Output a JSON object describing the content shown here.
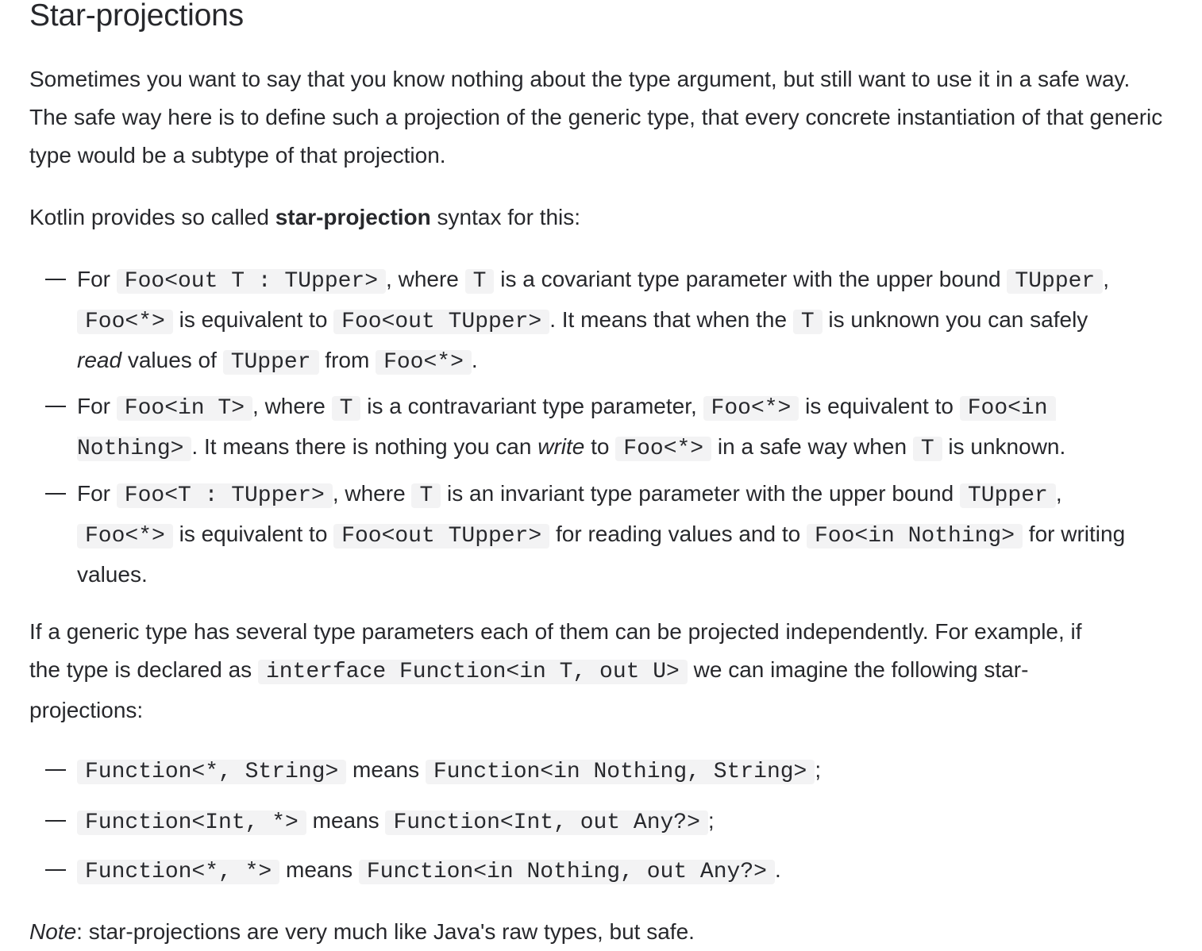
{
  "heading": "Star-projections",
  "intro": "Sometimes you want to say that you know nothing about the type argument, but still want to use it in a safe way. The safe way here is to define such a projection of the generic type, that every concrete instantiation of that generic type would be a subtype of that projection.",
  "kotlin_line": {
    "prefix": "Kotlin provides so called ",
    "bold": "star-projection",
    "suffix": " syntax for this:"
  },
  "projection_rules": [
    {
      "t1": "For ",
      "c1": "Foo<out T : TUpper>",
      "t2": ", where ",
      "c2": "T",
      "t3": " is a covariant type parameter with the upper bound ",
      "c3": "TUpper",
      "t4": ",",
      "c4": "Foo<*>",
      "t5": " is equivalent to ",
      "c5": "Foo<out TUpper>",
      "t6": ". It means that when the ",
      "c6": "T",
      "t7": " is unknown you can safely",
      "i1": "read",
      "t8": " values of ",
      "c7": "TUpper",
      "t9": " from ",
      "c8": "Foo<*>",
      "t10": "."
    },
    {
      "t1": "For ",
      "c1": "Foo<in T>",
      "t2": ", where ",
      "c2": "T",
      "t3": " is a contravariant type parameter, ",
      "c3": "Foo<*>",
      "t4": " is equivalent to ",
      "c4a": "Foo<in",
      "c4b": "Nothing>",
      "t5": ". It means there is nothing you can ",
      "i1": "write",
      "t6": " to ",
      "c5": "Foo<*>",
      "t7": " in a safe way when ",
      "c6": "T",
      "t8": " is unknown."
    },
    {
      "t1": "For ",
      "c1": "Foo<T : TUpper>",
      "t2": ", where ",
      "c2": "T",
      "t3": " is an invariant type parameter with the upper bound ",
      "c3": "TUpper",
      "t4": ",",
      "c4": "Foo<*>",
      "t5": " is equivalent to ",
      "c5": "Foo<out TUpper>",
      "t6": " for reading values and to ",
      "c6": "Foo<in Nothing>",
      "t7": " for writing",
      "t8": "values."
    }
  ],
  "multi_param": {
    "t1": "If a generic type has several type parameters each of them can be projected independently. For example, if",
    "t2": "the type is declared as ",
    "c1": "interface Function<in T, out U>",
    "t3": " we can imagine the following star-",
    "t4": "projections:"
  },
  "examples": [
    {
      "a": "Function<*, String>",
      "mid": " means ",
      "b": "Function<in Nothing, String>",
      "end": ";"
    },
    {
      "a": "Function<Int, *>",
      "mid": " means ",
      "b": "Function<Int, out Any?>",
      "end": ";"
    },
    {
      "a": "Function<*, *>",
      "mid": " means ",
      "b": "Function<in Nothing, out Any?>",
      "end": "."
    }
  ],
  "note": {
    "label": "Note",
    "text": ": star-projections are very much like Java's raw types, but safe."
  }
}
